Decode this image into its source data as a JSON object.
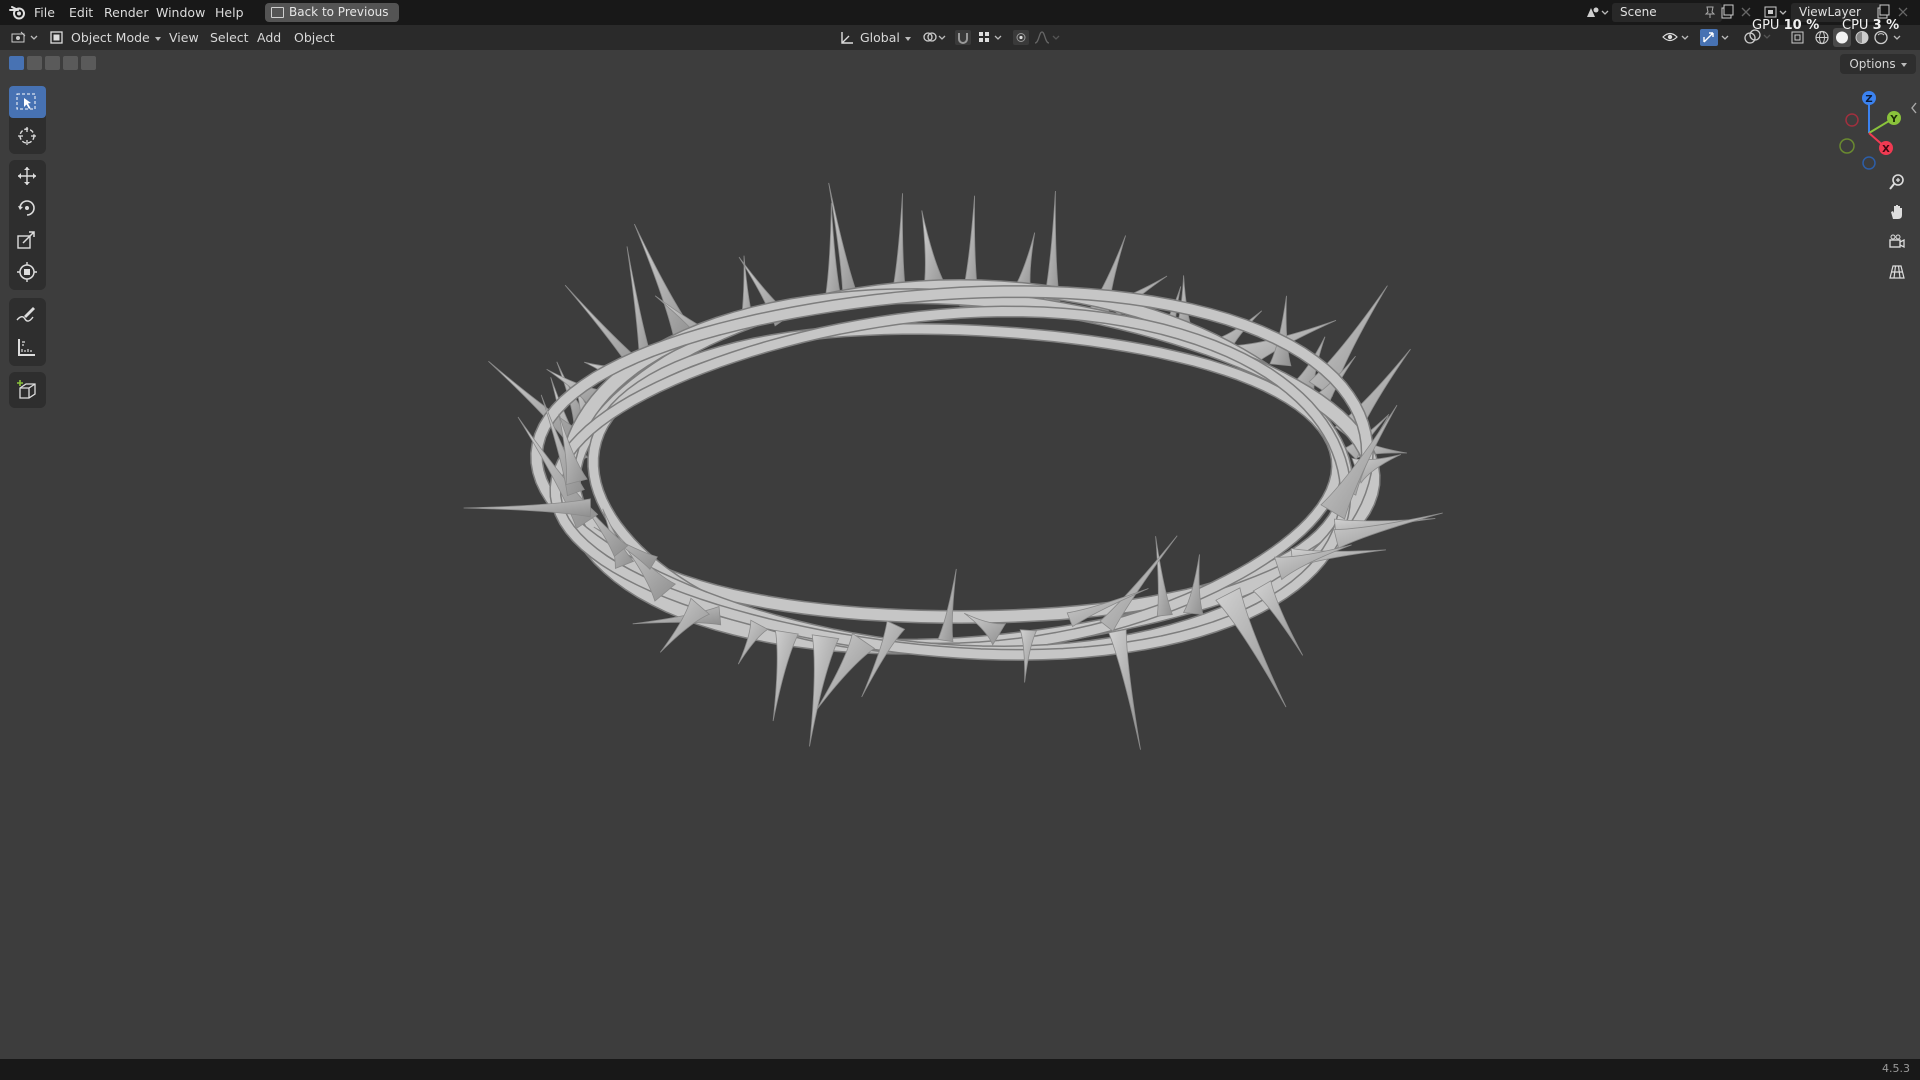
{
  "menu": {
    "file": "File",
    "edit": "Edit",
    "render": "Render",
    "window": "Window",
    "help": "Help",
    "back_button": "Back to Previous"
  },
  "workspace": {
    "scene_label": "Scene",
    "view_layer_label": "ViewLayer"
  },
  "header": {
    "mode": "Object Mode",
    "view": "View",
    "select": "Select",
    "add": "Add",
    "object": "Object",
    "transform_orientation": "Global",
    "options": "Options"
  },
  "stats": {
    "gpu_label": "GPU",
    "gpu_value": "10 %",
    "cpu_label": "CPU",
    "cpu_value": "3 %"
  },
  "toolbar": {
    "tools": [
      "select-box",
      "cursor",
      "move",
      "rotate",
      "scale",
      "transform",
      "annotate",
      "measure",
      "add-cube"
    ],
    "active_tool": "select-box"
  },
  "gizmo": {
    "x_label": "X",
    "y_label": "Y",
    "z_label": "Z",
    "x_color": "#f13a52",
    "y_color": "#8ac33b",
    "z_color": "#3b82f0"
  },
  "status": {
    "version": "4.5.3"
  },
  "colors": {
    "accent": "#4772b3",
    "viewport_bg": "#3d3d3d",
    "mesh": "#c4c4c4"
  }
}
